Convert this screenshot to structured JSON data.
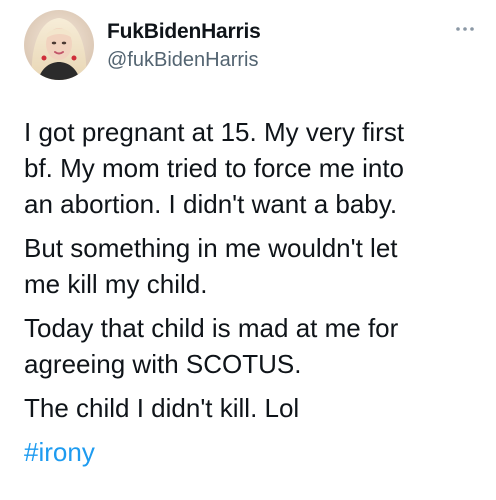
{
  "author": {
    "display_name": "FukBidenHarris",
    "handle": "@fukBidenHarris",
    "avatar_icon": "profile-photo"
  },
  "more_icon": "more-horizontal-icon",
  "tweet": {
    "paragraphs": [
      [
        "I got pregnant at 15. My very first",
        "bf. My mom tried to force me into",
        "an abortion. I didn't want a baby."
      ],
      [
        "But something in me wouldn't let",
        "me kill my child."
      ],
      [
        "Today that child is mad at me for",
        "agreeing with SCOTUS."
      ],
      [
        "The child I didn't kill.  Lol"
      ]
    ],
    "hashtag": "#irony"
  },
  "colors": {
    "text": "#0f1419",
    "secondary": "#536471",
    "link": "#1d9bf0"
  }
}
